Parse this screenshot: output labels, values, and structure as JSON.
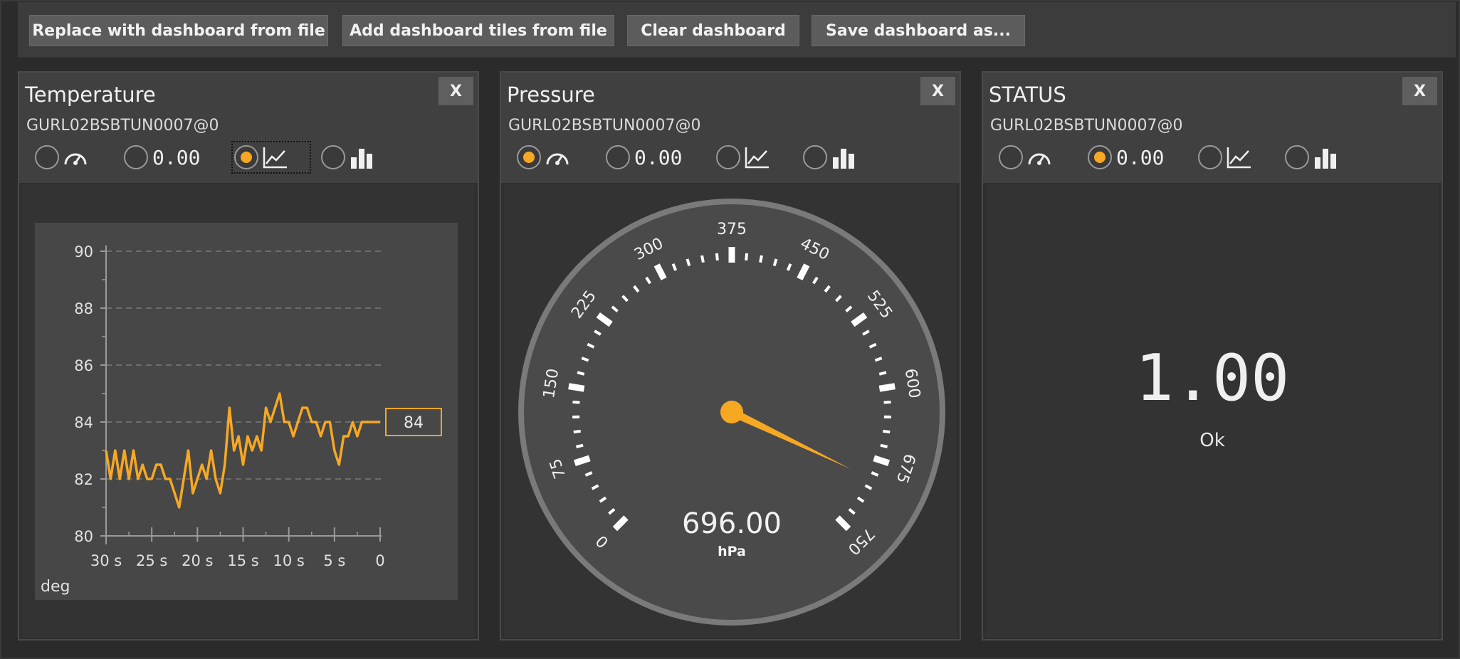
{
  "toolbar": {
    "replace_label": "Replace with dashboard from file",
    "add_label": "Add dashboard tiles from file",
    "clear_label": "Clear dashboard",
    "save_label": "Save dashboard as..."
  },
  "colors": {
    "accent": "#f7a823",
    "tile_header": "#404040",
    "background": "#2b2b2b"
  },
  "tiles": [
    {
      "title": "Temperature",
      "device": "GURL02BSBTUN0007@0",
      "close_label": "X",
      "numeric_option_label": "0.00",
      "view_options": [
        "gauge-icon",
        "numeric-value",
        "line-chart-icon",
        "bar-chart-icon"
      ],
      "selected_view": "line-chart-icon"
    },
    {
      "title": "Pressure",
      "device": "GURL02BSBTUN0007@0",
      "close_label": "X",
      "numeric_option_label": "0.00",
      "view_options": [
        "gauge-icon",
        "numeric-value",
        "line-chart-icon",
        "bar-chart-icon"
      ],
      "selected_view": "gauge-icon",
      "gauge": {
        "value": 696,
        "value_label": "696.00",
        "unit": "hPa",
        "min": 0,
        "max": 750,
        "tick_labels": [
          "0",
          "75",
          "150",
          "225",
          "300",
          "375",
          "450",
          "525",
          "600",
          "675",
          "750"
        ]
      }
    },
    {
      "title": "STATUS",
      "device": "GURL02BSBTUN0007@0",
      "close_label": "X",
      "numeric_option_label": "0.00",
      "view_options": [
        "gauge-icon",
        "numeric-value",
        "line-chart-icon",
        "bar-chart-icon"
      ],
      "selected_view": "numeric-value",
      "value_label": "1.00",
      "status_text": "Ok"
    }
  ],
  "chart_data": {
    "type": "line",
    "title": "",
    "xlabel": "",
    "ylabel": "deg",
    "x_ticks": [
      "30 s",
      "25 s",
      "20 s",
      "15 s",
      "10 s",
      "5 s",
      "0"
    ],
    "y_ticks": [
      "80",
      "82",
      "84",
      "86",
      "88",
      "90"
    ],
    "xlim": [
      -30,
      0
    ],
    "ylim": [
      80,
      90
    ],
    "grid": true,
    "current_value_label": "84",
    "series": [
      {
        "x": [
          -30,
          -29.5,
          -29,
          -28.5,
          -28,
          -27.5,
          -27,
          -26.5,
          -26,
          -25.5,
          -25,
          -24.5,
          -24,
          -23.5,
          -23,
          -22.5,
          -22,
          -21.5,
          -21,
          -20.5,
          -20,
          -19.5,
          -19,
          -18.5,
          -18,
          -17.5,
          -17,
          -16.5,
          -16,
          -15.5,
          -15,
          -14.5,
          -14,
          -13.5,
          -13,
          -12.5,
          -12,
          -11.5,
          -11,
          -10.5,
          -10,
          -9.5,
          -9,
          -8.5,
          -8,
          -7.5,
          -7,
          -6.5,
          -6,
          -5.5,
          -5,
          -4.5,
          -4,
          -3.5,
          -3,
          -2.5,
          -2,
          -1.5,
          -1,
          0
        ],
        "y": [
          83,
          82,
          83,
          82,
          83,
          82,
          83,
          82,
          82.5,
          82,
          82,
          82.5,
          82.5,
          82,
          82,
          81.5,
          81,
          82,
          83,
          81.5,
          82,
          82.5,
          82,
          83,
          82,
          81.5,
          82.5,
          84.5,
          83,
          83.5,
          82.5,
          83.5,
          83,
          83.5,
          83,
          84.5,
          84,
          84.5,
          85,
          84,
          84,
          83.5,
          84,
          84.5,
          84.5,
          84,
          84,
          83.5,
          84,
          84,
          83,
          82.5,
          83.5,
          83.5,
          84,
          83.5,
          84,
          84,
          84,
          84
        ]
      }
    ]
  }
}
